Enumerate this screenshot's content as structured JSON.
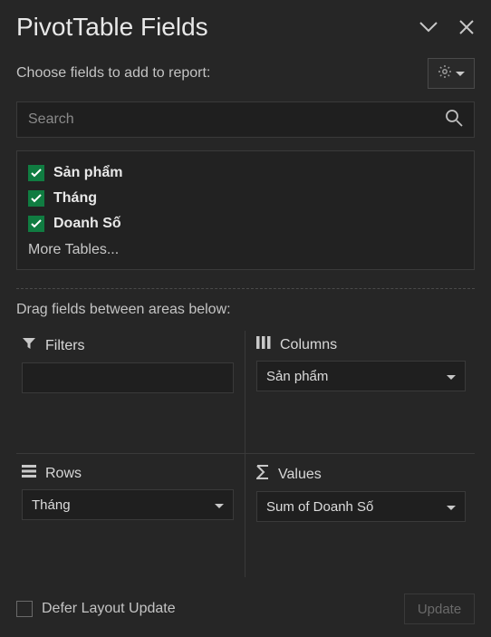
{
  "header": {
    "title": "PivotTable Fields"
  },
  "subheader": {
    "label": "Choose fields to add to report:"
  },
  "search": {
    "placeholder": "Search"
  },
  "fields": {
    "items": [
      {
        "label": "Sản phẩm",
        "checked": true
      },
      {
        "label": "Tháng",
        "checked": true
      },
      {
        "label": "Doanh Số",
        "checked": true
      }
    ],
    "more_label": "More Tables..."
  },
  "drag_label": "Drag fields between areas below:",
  "areas": {
    "filters": {
      "title": "Filters",
      "value": ""
    },
    "columns": {
      "title": "Columns",
      "value": "Sản phẩm"
    },
    "rows": {
      "title": "Rows",
      "value": "Tháng"
    },
    "values": {
      "title": "Values",
      "value": "Sum of Doanh Số"
    }
  },
  "footer": {
    "defer_label": "Defer Layout Update",
    "update_label": "Update"
  }
}
